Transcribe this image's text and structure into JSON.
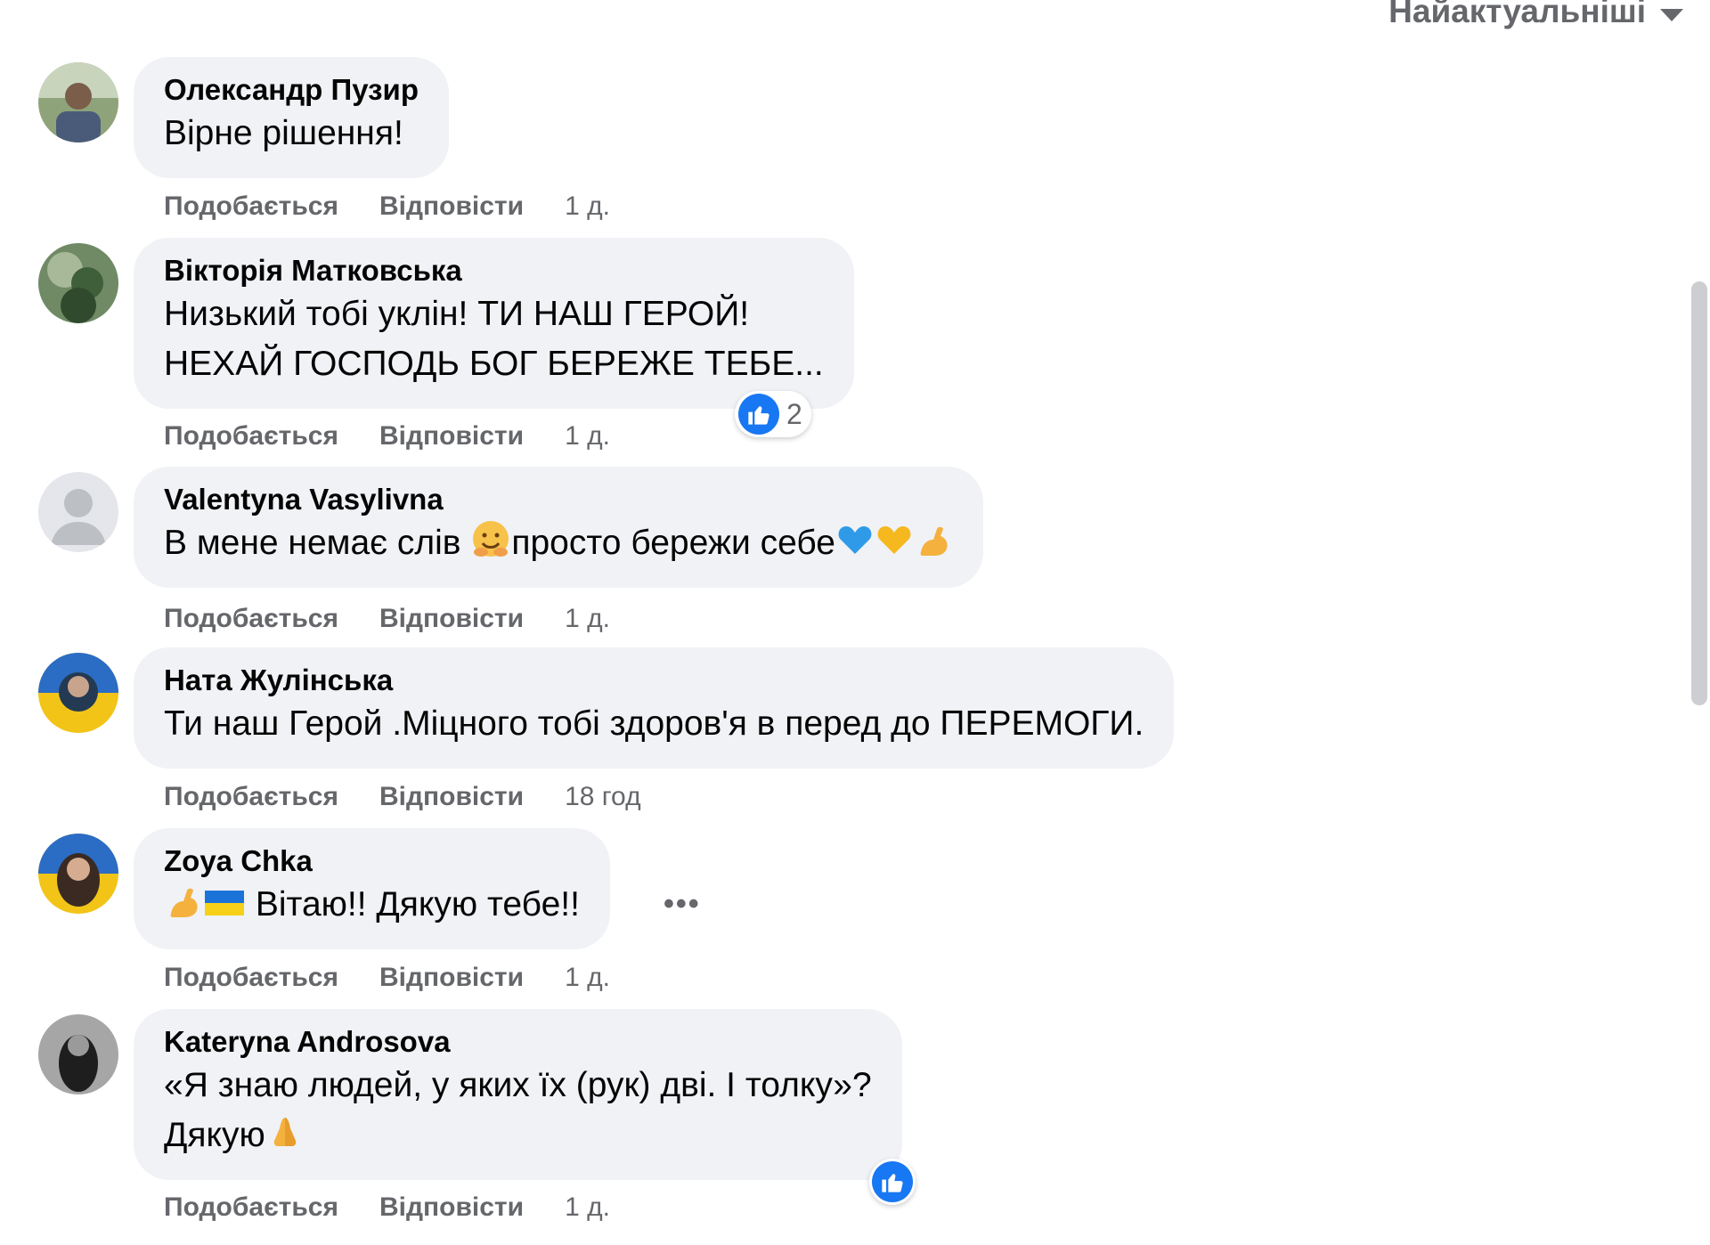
{
  "sort": {
    "label": "Найактуальніші"
  },
  "actions": {
    "like": "Подобається",
    "reply": "Відповісти"
  },
  "comments": [
    {
      "author": "Олександр Пузир",
      "lines": [
        "Вірне рішення!"
      ],
      "time": "1 д."
    },
    {
      "author": "Вікторія Матковська",
      "lines": [
        "Низький тобі уклін! ТИ НАШ ГЕРОЙ!",
        "НЕХАЙ ГОСПОДЬ БОГ БЕРЕЖЕ ТЕБЕ..."
      ],
      "time": "1 д.",
      "reaction_count": "2"
    },
    {
      "author": "Valentyna Vasylivna",
      "lines": [
        "В мене немає слів",
        "просто бережи себе"
      ],
      "time": "1 д."
    },
    {
      "author": "Ната Жулінська",
      "lines": [
        "Ти наш Герой .Міцного тобі здоров'я в перед до ПЕРЕМОГИ."
      ],
      "time": "18 год"
    },
    {
      "author": "Zoya Chka",
      "lines": [
        "Вітаю!! Дякую тебе!!"
      ],
      "time": "1 д."
    },
    {
      "author": "Kateryna Androsova",
      "lines": [
        "«Я знаю людей, у яких їх (рук) дві. І толку»?",
        "Дякую"
      ],
      "time": "1 д."
    }
  ],
  "icons": [
    "sort-caret-icon",
    "like-reaction-icon",
    "more-options-icon"
  ],
  "colors": {
    "bubble": "#f0f2f5",
    "secondary_text": "#65676b",
    "like_blue": "#1877f2"
  }
}
